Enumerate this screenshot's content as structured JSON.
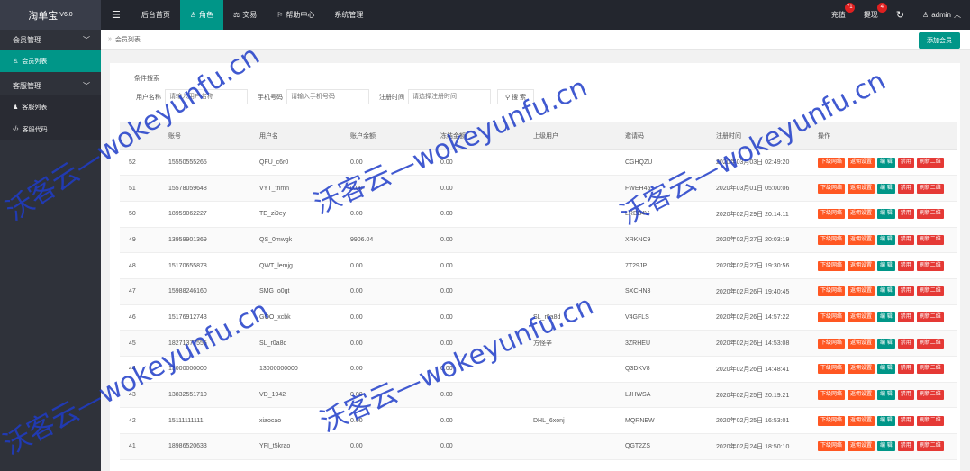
{
  "topbar": {
    "logo": "淘单宝",
    "version": "V6.0",
    "nav": [
      {
        "label": "后台首页",
        "icon": "home"
      },
      {
        "label": "角色",
        "icon": "user-icon",
        "active": true
      },
      {
        "label": "交易",
        "icon": "scale-icon"
      },
      {
        "label": "帮助中心",
        "icon": "flag-icon"
      },
      {
        "label": "系统管理",
        "icon": ""
      }
    ],
    "recharge": {
      "label": "充值",
      "count": "71"
    },
    "withdraw": {
      "label": "提现",
      "count": "4"
    },
    "user": "admin"
  },
  "sidebar": {
    "groups": [
      {
        "label": "会员管理",
        "items": [
          {
            "label": "会员列表",
            "active": true
          }
        ]
      },
      {
        "label": "客服管理",
        "items": [
          {
            "label": "客服列表"
          },
          {
            "label": "客服代码"
          }
        ]
      }
    ]
  },
  "breadcrumb": "会员列表",
  "add_button": "添加会员",
  "search": {
    "title": "条件搜索",
    "username_label": "用户名称",
    "username_placeholder": "请输入用户名称",
    "phone_label": "手机号码",
    "phone_placeholder": "请输入手机号码",
    "regtime_label": "注册时间",
    "regtime_placeholder": "请选择注册时间",
    "button": "搜 索"
  },
  "table": {
    "headers": [
      "",
      "账号",
      "用户名",
      "账户余额",
      "冻结金额",
      "上级用户",
      "邀请码",
      "注册时间",
      "操作"
    ],
    "ops": [
      "下级网络",
      "返佣设置",
      "编 辑",
      "禁用",
      "刷新二维"
    ],
    "rows": [
      [
        "52",
        "15550555265",
        "QFU_c6r0",
        "0.00",
        "0.00",
        "",
        "CGHQZU",
        "2020年03月03日 02:49:20"
      ],
      [
        "51",
        "15578059648",
        "VYT_tnmn",
        "0.00",
        "0.00",
        "",
        "FWEH45",
        "2020年03月01日 05:00:06"
      ],
      [
        "50",
        "18959062227",
        "TE_zi9ey",
        "0.00",
        "0.00",
        "",
        "LRBB4V",
        "2020年02月29日 20:14:11"
      ],
      [
        "49",
        "13959901369",
        "QS_0mwgk",
        "9906.04",
        "0.00",
        "",
        "XRKNC9",
        "2020年02月27日 20:03:19"
      ],
      [
        "48",
        "15170655878",
        "QWT_lemjg",
        "0.00",
        "0.00",
        "",
        "7T29JP",
        "2020年02月27日 19:30:56"
      ],
      [
        "47",
        "15988246160",
        "SMG_o0gt",
        "0.00",
        "0.00",
        "",
        "SXCHN3",
        "2020年02月26日 19:40:45"
      ],
      [
        "46",
        "15176912743",
        "GOO_xcbk",
        "0.00",
        "0.00",
        "SL_r0a8d",
        "V4GFLS",
        "2020年02月26日 14:57:22"
      ],
      [
        "45",
        "18271377555",
        "SL_r0a8d",
        "0.00",
        "0.00",
        "方怪辛",
        "3ZRHEU",
        "2020年02月26日 14:53:08"
      ],
      [
        "44",
        "13000000000",
        "13000000000",
        "0.00",
        "0.00",
        "",
        "Q3DKV8",
        "2020年02月26日 14:48:41"
      ],
      [
        "43",
        "13832551710",
        "VD_1942",
        "0.00",
        "0.00",
        "",
        "LJHWSA",
        "2020年02月25日 20:19:21"
      ],
      [
        "42",
        "15111111111",
        "xiaocao",
        "0.00",
        "0.00",
        "DHL_6xonj",
        "MQRNEW",
        "2020年02月25日 16:53:01"
      ],
      [
        "41",
        "18986520633",
        "YFI_t5krao",
        "0.00",
        "0.00",
        "",
        "QGT2ZS",
        "2020年02月24日 18:50:10"
      ]
    ]
  },
  "watermarks": [
    "沃客云—wokeyunfu.cn",
    "沃客云—wokeyunfu.cn",
    "沃客云—wokeyunfu.cn",
    "沃客云—wokeyunfu.cn",
    "沃客云—wokeyunfu.cn"
  ]
}
